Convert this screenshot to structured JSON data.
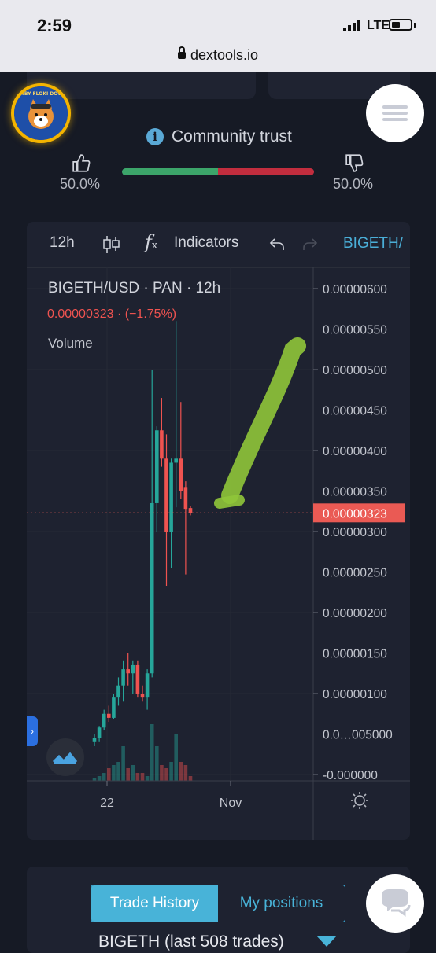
{
  "status_bar": {
    "time": "2:59",
    "network": "LTE",
    "url": "dextools.io"
  },
  "header": {
    "token_logo_text": "BABY FLOKI DOGE",
    "community_trust_label": "Community trust",
    "thumbs_up_pct": "50.0%",
    "thumbs_down_pct": "50.0%",
    "trust_up_fraction": 0.5,
    "colors": {
      "up": "#3ca56a",
      "down": "#c22d3e",
      "accent": "#48b3d8"
    }
  },
  "chart_toolbar": {
    "interval": "12h",
    "indicators_label": "Indicators",
    "pair_tab": "BIGETH/"
  },
  "chart_legend": {
    "symbol": "BIGETH/USD · PAN · 12h",
    "price_change": "0.00000323  ·  (−1.75%)",
    "volume_label": "Volume"
  },
  "chart_data": {
    "type": "candlestick",
    "title": "BIGETH/USD · PAN · 12h",
    "y_ticks": [
      "0.00000600",
      "0.00000550",
      "0.00000500",
      "0.00000450",
      "0.00000400",
      "0.00000350",
      "0.00000300",
      "0.00000250",
      "0.00000200",
      "0.00000150",
      "0.00000100",
      "0.0…005000",
      "-0.000000"
    ],
    "y_tick_values": [
      6e-06,
      5.5e-06,
      5e-06,
      4.5e-06,
      4e-06,
      3.5e-06,
      3e-06,
      2.5e-06,
      2e-06,
      1.5e-06,
      1e-06,
      5e-07,
      0
    ],
    "x_ticks": [
      "22",
      "Nov"
    ],
    "ylim": [
      0,
      6e-06
    ],
    "current_price": "0.00000323",
    "current_price_value": 3.23e-06,
    "candles": [
      {
        "o": 4e-07,
        "h": 5e-07,
        "l": 3.5e-07,
        "c": 4.5e-07
      },
      {
        "o": 4.5e-07,
        "h": 6e-07,
        "l": 4e-07,
        "c": 5.8e-07
      },
      {
        "o": 5.8e-07,
        "h": 8e-07,
        "l": 5.5e-07,
        "c": 7.5e-07
      },
      {
        "o": 7.5e-07,
        "h": 8.5e-07,
        "l": 6.5e-07,
        "c": 7e-07
      },
      {
        "o": 7e-07,
        "h": 1e-06,
        "l": 6.8e-07,
        "c": 9.5e-07
      },
      {
        "o": 9.5e-07,
        "h": 1.2e-06,
        "l": 8.5e-07,
        "c": 1.1e-06
      },
      {
        "o": 1.1e-06,
        "h": 1.4e-06,
        "l": 9e-07,
        "c": 1.3e-06
      },
      {
        "o": 1.3e-06,
        "h": 1.5e-06,
        "l": 1.1e-06,
        "c": 1.25e-06
      },
      {
        "o": 1.25e-06,
        "h": 1.4e-06,
        "l": 1e-06,
        "c": 1.35e-06
      },
      {
        "o": 1.35e-06,
        "h": 1.4e-06,
        "l": 9.5e-07,
        "c": 1e-06
      },
      {
        "o": 1e-06,
        "h": 1.1e-06,
        "l": 9e-07,
        "c": 9.5e-07
      },
      {
        "o": 9.5e-07,
        "h": 1.3e-06,
        "l": 8e-07,
        "c": 1.25e-06
      },
      {
        "o": 1.25e-06,
        "h": 5e-06,
        "l": 1.2e-06,
        "c": 3.35e-06
      },
      {
        "o": 3.35e-06,
        "h": 4.3e-06,
        "l": 3e-06,
        "c": 4.25e-06
      },
      {
        "o": 4.25e-06,
        "h": 4.65e-06,
        "l": 3.8e-06,
        "c": 3.9e-06
      },
      {
        "o": 3.9e-06,
        "h": 4.2e-06,
        "l": 2.33e-06,
        "c": 3e-06
      },
      {
        "o": 3e-06,
        "h": 3.9e-06,
        "l": 2.55e-06,
        "c": 3.85e-06
      },
      {
        "o": 3.85e-06,
        "h": 5.6e-06,
        "l": 3.3e-06,
        "c": 3.9e-06
      },
      {
        "o": 3.9e-06,
        "h": 4.6e-06,
        "l": 3.4e-06,
        "c": 3.5e-06
      },
      {
        "o": 3.55e-06,
        "h": 3.62e-06,
        "l": 2.47e-06,
        "c": 3.28e-06
      },
      {
        "o": 3.29e-06,
        "h": 3.32e-06,
        "l": 3.2e-06,
        "c": 3.23e-06
      }
    ],
    "volumes": [
      0.02,
      0.03,
      0.05,
      0.08,
      0.1,
      0.12,
      0.22,
      0.08,
      0.1,
      0.05,
      0.05,
      0.03,
      0.36,
      0.22,
      0.1,
      0.08,
      0.12,
      0.3,
      0.12,
      0.1,
      0.03
    ],
    "colors": {
      "up": "#26a69a",
      "down": "#ef5350",
      "price_label_bg": "#ea5a54"
    }
  },
  "trade_tabs": {
    "active": "Trade History",
    "inactive": "My positions"
  },
  "trade_history_title": "BIGETH (last 508 trades)",
  "icons": [
    "lock-icon",
    "info-icon",
    "thumbs-up-icon",
    "thumbs-down-icon",
    "menu-icon",
    "candle-style-icon",
    "fx-icon",
    "undo-icon",
    "redo-icon",
    "settings-gear-icon",
    "tradingview-logo-icon",
    "chat-icon",
    "chevron-right-icon"
  ]
}
